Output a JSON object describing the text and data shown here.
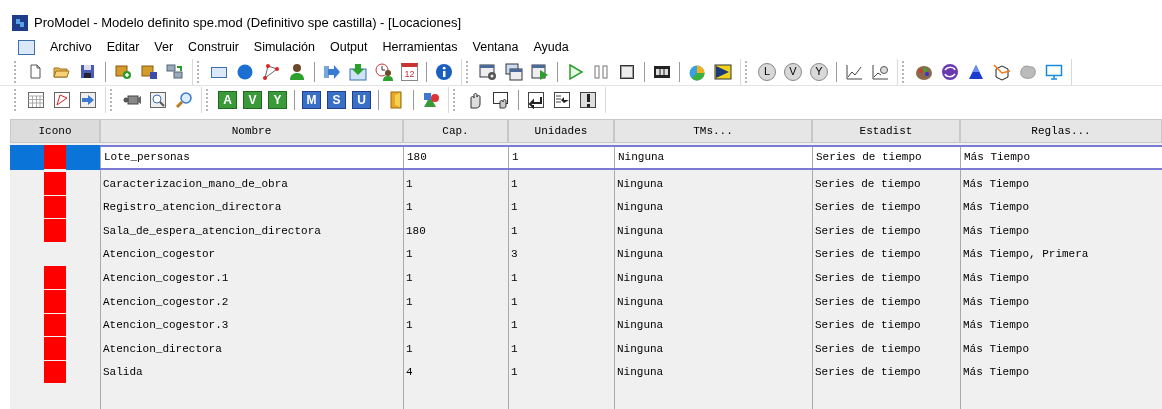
{
  "window": {
    "title": "ProModel - Modelo definito spe.mod (Definitivo spe castilla) - [Locaciones]"
  },
  "menu": [
    "Archivo",
    "Editar",
    "Ver",
    "Construir",
    "Simulación",
    "Output",
    "Herramientas",
    "Ventana",
    "Ayuda"
  ],
  "toolbar_1": [
    [
      {
        "kind": "new"
      },
      {
        "kind": "open"
      },
      {
        "kind": "save"
      },
      {
        "kind": "sep"
      },
      {
        "kind": "crate-add"
      },
      {
        "kind": "crate-save"
      },
      {
        "kind": "computers"
      }
    ],
    [
      {
        "kind": "rect"
      },
      {
        "kind": "circle"
      },
      {
        "kind": "path"
      },
      {
        "kind": "person"
      },
      {
        "kind": "sep"
      },
      {
        "kind": "arrow-right"
      },
      {
        "kind": "download"
      },
      {
        "kind": "clock-person"
      },
      {
        "kind": "calendar",
        "label": "12"
      },
      {
        "kind": "sep"
      },
      {
        "kind": "info"
      }
    ],
    [
      {
        "kind": "window-gear"
      },
      {
        "kind": "windows"
      },
      {
        "kind": "window-play"
      },
      {
        "kind": "sep"
      },
      {
        "kind": "play"
      },
      {
        "kind": "pause"
      },
      {
        "kind": "stop"
      },
      {
        "kind": "sep"
      },
      {
        "kind": "film"
      },
      {
        "kind": "sep"
      },
      {
        "kind": "pie"
      },
      {
        "kind": "arrow-flag"
      }
    ],
    [
      {
        "kind": "bubble",
        "label": "L"
      },
      {
        "kind": "bubble",
        "label": "V"
      },
      {
        "kind": "bubble",
        "label": "Y"
      },
      {
        "kind": "sep"
      },
      {
        "kind": "chart"
      },
      {
        "kind": "chart-search"
      }
    ],
    [
      {
        "kind": "palette"
      },
      {
        "kind": "swirl"
      },
      {
        "kind": "triangle"
      },
      {
        "kind": "box-arrow"
      },
      {
        "kind": "rock"
      },
      {
        "kind": "monitor"
      }
    ]
  ],
  "toolbar_2": [
    [
      {
        "kind": "grid"
      },
      {
        "kind": "path-window"
      },
      {
        "kind": "window-arrow"
      }
    ],
    [
      {
        "kind": "camera"
      },
      {
        "kind": "zoom-window"
      },
      {
        "kind": "search"
      }
    ],
    [
      {
        "kind": "green-letter",
        "label": "A"
      },
      {
        "kind": "green-letter",
        "label": "V"
      },
      {
        "kind": "green-letter",
        "label": "Y"
      },
      {
        "kind": "sep"
      },
      {
        "kind": "blue-letter",
        "label": "M"
      },
      {
        "kind": "blue-letter",
        "label": "S"
      },
      {
        "kind": "blue-letter",
        "label": "U"
      },
      {
        "kind": "sep"
      },
      {
        "kind": "door"
      },
      {
        "kind": "sep"
      },
      {
        "kind": "shapes"
      }
    ],
    [
      {
        "kind": "hand"
      },
      {
        "kind": "hand-window"
      },
      {
        "kind": "sep"
      },
      {
        "kind": "window-enter"
      },
      {
        "kind": "list-arrow"
      },
      {
        "kind": "warning"
      }
    ]
  ],
  "table": {
    "icon_column": "Icono",
    "columns": [
      "Nombre",
      "Cap.",
      "Unidades",
      "TMs...",
      "Estadist",
      "Reglas..."
    ],
    "rows": [
      {
        "icon": true,
        "selected": true,
        "cells": [
          "Lote_personas",
          "180",
          "1",
          "Ninguna",
          "Series de tiempo",
          "Más Tiempo"
        ]
      },
      {
        "icon": true,
        "selected": false,
        "cells": [
          "Caracterizacion_mano_de_obra",
          "1",
          "1",
          "Ninguna",
          "Series de tiempo",
          "Más Tiempo"
        ]
      },
      {
        "icon": true,
        "selected": false,
        "cells": [
          "Registro_atencion_directora",
          "1",
          "1",
          "Ninguna",
          "Series de tiempo",
          "Más Tiempo"
        ]
      },
      {
        "icon": true,
        "selected": false,
        "cells": [
          "Sala_de_espera_atencion_directora",
          "180",
          "1",
          "Ninguna",
          "Series de tiempo",
          "Más Tiempo"
        ]
      },
      {
        "icon": false,
        "selected": false,
        "cells": [
          "Atencion_cogestor",
          "1",
          "3",
          "Ninguna",
          "Series de tiempo",
          "Más Tiempo, Primera"
        ]
      },
      {
        "icon": true,
        "selected": false,
        "cells": [
          "Atencion_cogestor.1",
          "1",
          "1",
          "Ninguna",
          "Series de tiempo",
          "Más Tiempo"
        ]
      },
      {
        "icon": true,
        "selected": false,
        "cells": [
          "Atencion_cogestor.2",
          "1",
          "1",
          "Ninguna",
          "Series de tiempo",
          "Más Tiempo"
        ]
      },
      {
        "icon": true,
        "selected": false,
        "cells": [
          "Atencion_cogestor.3",
          "1",
          "1",
          "Ninguna",
          "Series de tiempo",
          "Más Tiempo"
        ]
      },
      {
        "icon": true,
        "selected": false,
        "cells": [
          "Atencion_directora",
          "1",
          "1",
          "Ninguna",
          "Series de tiempo",
          "Más Tiempo"
        ]
      },
      {
        "icon": true,
        "selected": false,
        "cells": [
          "Salida",
          "4",
          "1",
          "Ninguna",
          "Series de tiempo",
          "Más Tiempo"
        ]
      }
    ]
  }
}
